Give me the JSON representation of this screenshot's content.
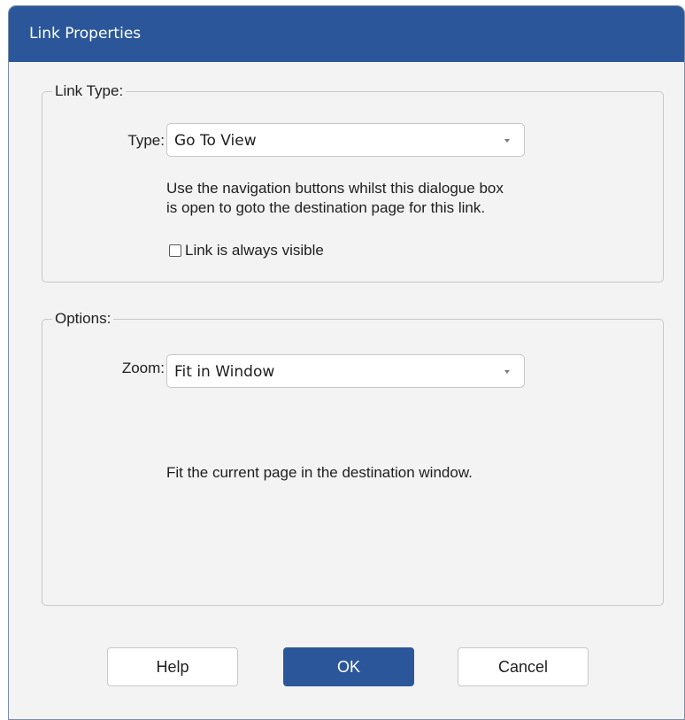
{
  "dialog": {
    "title": "Link Properties"
  },
  "link_type_group": {
    "legend": "Link Type:",
    "type_label": "Type:",
    "type_value": "Go To View",
    "description_line1": "Use the navigation buttons whilst this dialogue box",
    "description_line2": "is open to goto the destination page for this link.",
    "checkbox_label": "Link is always visible",
    "checkbox_checked": false
  },
  "options_group": {
    "legend": "Options:",
    "zoom_label": "Zoom:",
    "zoom_value": "Fit in Window",
    "description": "Fit the current page in the destination window."
  },
  "buttons": {
    "help": "Help",
    "ok": "OK",
    "cancel": "Cancel"
  },
  "colors": {
    "accent": "#2b579a",
    "dialog_background": "#f3f3f3"
  }
}
